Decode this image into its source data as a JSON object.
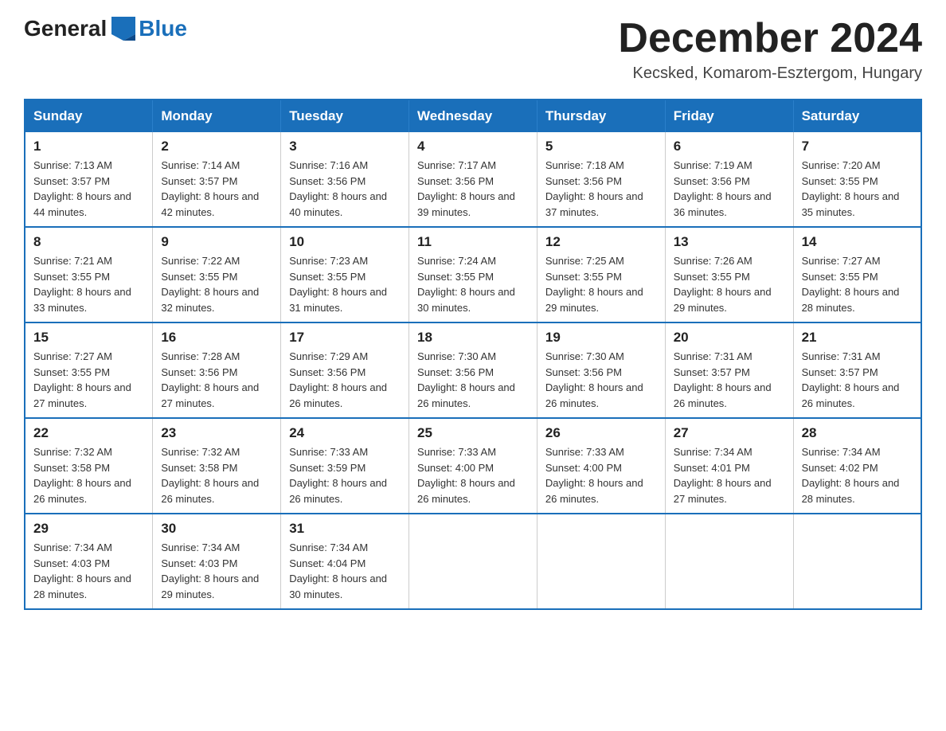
{
  "logo": {
    "text_general": "General",
    "text_blue": "Blue"
  },
  "title": "December 2024",
  "subtitle": "Kecsked, Komarom-Esztergom, Hungary",
  "headers": [
    "Sunday",
    "Monday",
    "Tuesday",
    "Wednesday",
    "Thursday",
    "Friday",
    "Saturday"
  ],
  "weeks": [
    [
      {
        "day": "1",
        "sunrise": "7:13 AM",
        "sunset": "3:57 PM",
        "daylight": "8 hours and 44 minutes."
      },
      {
        "day": "2",
        "sunrise": "7:14 AM",
        "sunset": "3:57 PM",
        "daylight": "8 hours and 42 minutes."
      },
      {
        "day": "3",
        "sunrise": "7:16 AM",
        "sunset": "3:56 PM",
        "daylight": "8 hours and 40 minutes."
      },
      {
        "day": "4",
        "sunrise": "7:17 AM",
        "sunset": "3:56 PM",
        "daylight": "8 hours and 39 minutes."
      },
      {
        "day": "5",
        "sunrise": "7:18 AM",
        "sunset": "3:56 PM",
        "daylight": "8 hours and 37 minutes."
      },
      {
        "day": "6",
        "sunrise": "7:19 AM",
        "sunset": "3:56 PM",
        "daylight": "8 hours and 36 minutes."
      },
      {
        "day": "7",
        "sunrise": "7:20 AM",
        "sunset": "3:55 PM",
        "daylight": "8 hours and 35 minutes."
      }
    ],
    [
      {
        "day": "8",
        "sunrise": "7:21 AM",
        "sunset": "3:55 PM",
        "daylight": "8 hours and 33 minutes."
      },
      {
        "day": "9",
        "sunrise": "7:22 AM",
        "sunset": "3:55 PM",
        "daylight": "8 hours and 32 minutes."
      },
      {
        "day": "10",
        "sunrise": "7:23 AM",
        "sunset": "3:55 PM",
        "daylight": "8 hours and 31 minutes."
      },
      {
        "day": "11",
        "sunrise": "7:24 AM",
        "sunset": "3:55 PM",
        "daylight": "8 hours and 30 minutes."
      },
      {
        "day": "12",
        "sunrise": "7:25 AM",
        "sunset": "3:55 PM",
        "daylight": "8 hours and 29 minutes."
      },
      {
        "day": "13",
        "sunrise": "7:26 AM",
        "sunset": "3:55 PM",
        "daylight": "8 hours and 29 minutes."
      },
      {
        "day": "14",
        "sunrise": "7:27 AM",
        "sunset": "3:55 PM",
        "daylight": "8 hours and 28 minutes."
      }
    ],
    [
      {
        "day": "15",
        "sunrise": "7:27 AM",
        "sunset": "3:55 PM",
        "daylight": "8 hours and 27 minutes."
      },
      {
        "day": "16",
        "sunrise": "7:28 AM",
        "sunset": "3:56 PM",
        "daylight": "8 hours and 27 minutes."
      },
      {
        "day": "17",
        "sunrise": "7:29 AM",
        "sunset": "3:56 PM",
        "daylight": "8 hours and 26 minutes."
      },
      {
        "day": "18",
        "sunrise": "7:30 AM",
        "sunset": "3:56 PM",
        "daylight": "8 hours and 26 minutes."
      },
      {
        "day": "19",
        "sunrise": "7:30 AM",
        "sunset": "3:56 PM",
        "daylight": "8 hours and 26 minutes."
      },
      {
        "day": "20",
        "sunrise": "7:31 AM",
        "sunset": "3:57 PM",
        "daylight": "8 hours and 26 minutes."
      },
      {
        "day": "21",
        "sunrise": "7:31 AM",
        "sunset": "3:57 PM",
        "daylight": "8 hours and 26 minutes."
      }
    ],
    [
      {
        "day": "22",
        "sunrise": "7:32 AM",
        "sunset": "3:58 PM",
        "daylight": "8 hours and 26 minutes."
      },
      {
        "day": "23",
        "sunrise": "7:32 AM",
        "sunset": "3:58 PM",
        "daylight": "8 hours and 26 minutes."
      },
      {
        "day": "24",
        "sunrise": "7:33 AM",
        "sunset": "3:59 PM",
        "daylight": "8 hours and 26 minutes."
      },
      {
        "day": "25",
        "sunrise": "7:33 AM",
        "sunset": "4:00 PM",
        "daylight": "8 hours and 26 minutes."
      },
      {
        "day": "26",
        "sunrise": "7:33 AM",
        "sunset": "4:00 PM",
        "daylight": "8 hours and 26 minutes."
      },
      {
        "day": "27",
        "sunrise": "7:34 AM",
        "sunset": "4:01 PM",
        "daylight": "8 hours and 27 minutes."
      },
      {
        "day": "28",
        "sunrise": "7:34 AM",
        "sunset": "4:02 PM",
        "daylight": "8 hours and 28 minutes."
      }
    ],
    [
      {
        "day": "29",
        "sunrise": "7:34 AM",
        "sunset": "4:03 PM",
        "daylight": "8 hours and 28 minutes."
      },
      {
        "day": "30",
        "sunrise": "7:34 AM",
        "sunset": "4:03 PM",
        "daylight": "8 hours and 29 minutes."
      },
      {
        "day": "31",
        "sunrise": "7:34 AM",
        "sunset": "4:04 PM",
        "daylight": "8 hours and 30 minutes."
      },
      null,
      null,
      null,
      null
    ]
  ]
}
